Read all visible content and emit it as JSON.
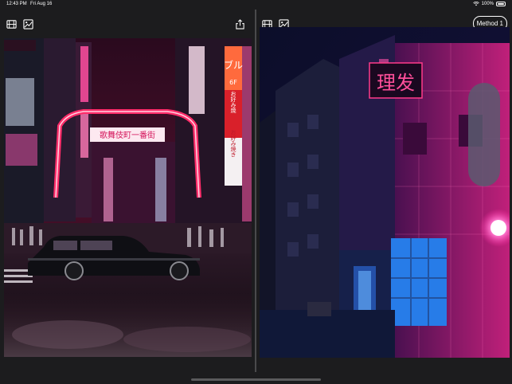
{
  "status_bar": {
    "time": "12:43 PM",
    "date": "Fri Aug 16",
    "battery_percent": "100%",
    "icons": [
      "wifi-icon",
      "battery-icon"
    ]
  },
  "left_panel": {
    "icons": [
      "film-icon",
      "image-edit-icon",
      "share-icon"
    ],
    "photo": {
      "subject": "Tokyo street at night with neon signs and taxi",
      "signs": {
        "arch": "歌舞伎町一番街",
        "tower1": "ブル",
        "tower1_sub": "6F",
        "tower2": "お好み焼",
        "tower2_sub": "8F",
        "tower3": "お好み焼き",
        "tower3_sub": "本店"
      }
    }
  },
  "right_panel": {
    "icons": [
      "film-icon",
      "image-edit-icon"
    ],
    "method_button": "Method 1",
    "photo": {
      "subject": "Neon-lit building with blue window at night",
      "sign": "理发"
    }
  },
  "colors": {
    "background": "#1c1c1e",
    "neon_pink": "#ff3d8b",
    "neon_blue": "#3aa0ff",
    "neon_magenta": "#d21e7a"
  }
}
